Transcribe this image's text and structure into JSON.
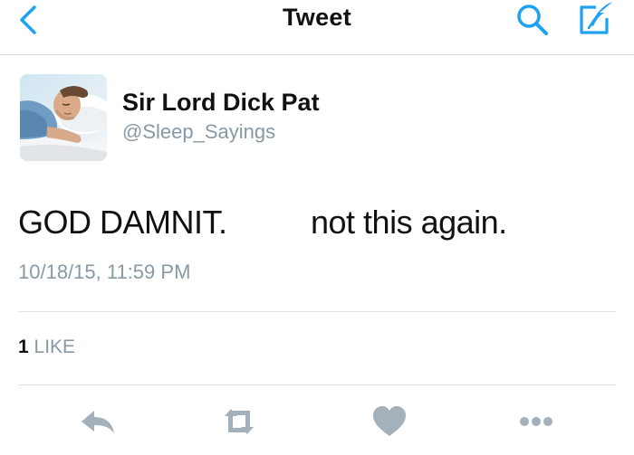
{
  "nav": {
    "title": "Tweet",
    "back_icon": "chevron-left-icon",
    "search_icon": "search-icon",
    "compose_icon": "compose-icon",
    "accent_color": "#1da1f2"
  },
  "tweet": {
    "author": {
      "display_name": "Sir Lord Dick Pat",
      "handle": "@Sleep_Sayings"
    },
    "text_part_1": "GOD DAMNIT.",
    "text_part_2": "not this again.",
    "timestamp": "10/18/15, 11:59 PM",
    "likes": {
      "count": "1",
      "label": "LIKE"
    }
  },
  "actions": {
    "reply_icon": "reply-icon",
    "retweet_icon": "retweet-icon",
    "like_icon": "heart-icon",
    "more_icon": "more-icon",
    "icon_color": "#a4b0ba"
  }
}
